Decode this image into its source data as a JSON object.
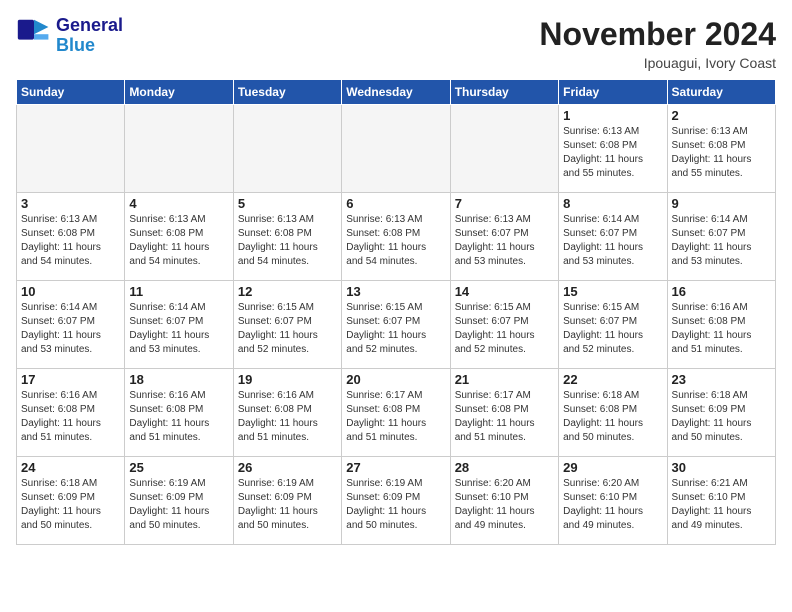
{
  "header": {
    "logo_line1": "General",
    "logo_line2": "Blue",
    "month_title": "November 2024",
    "location": "Ipouagui, Ivory Coast"
  },
  "weekdays": [
    "Sunday",
    "Monday",
    "Tuesday",
    "Wednesday",
    "Thursday",
    "Friday",
    "Saturday"
  ],
  "weeks": [
    [
      {
        "day": "",
        "info": ""
      },
      {
        "day": "",
        "info": ""
      },
      {
        "day": "",
        "info": ""
      },
      {
        "day": "",
        "info": ""
      },
      {
        "day": "",
        "info": ""
      },
      {
        "day": "1",
        "info": "Sunrise: 6:13 AM\nSunset: 6:08 PM\nDaylight: 11 hours\nand 55 minutes."
      },
      {
        "day": "2",
        "info": "Sunrise: 6:13 AM\nSunset: 6:08 PM\nDaylight: 11 hours\nand 55 minutes."
      }
    ],
    [
      {
        "day": "3",
        "info": "Sunrise: 6:13 AM\nSunset: 6:08 PM\nDaylight: 11 hours\nand 54 minutes."
      },
      {
        "day": "4",
        "info": "Sunrise: 6:13 AM\nSunset: 6:08 PM\nDaylight: 11 hours\nand 54 minutes."
      },
      {
        "day": "5",
        "info": "Sunrise: 6:13 AM\nSunset: 6:08 PM\nDaylight: 11 hours\nand 54 minutes."
      },
      {
        "day": "6",
        "info": "Sunrise: 6:13 AM\nSunset: 6:08 PM\nDaylight: 11 hours\nand 54 minutes."
      },
      {
        "day": "7",
        "info": "Sunrise: 6:13 AM\nSunset: 6:07 PM\nDaylight: 11 hours\nand 53 minutes."
      },
      {
        "day": "8",
        "info": "Sunrise: 6:14 AM\nSunset: 6:07 PM\nDaylight: 11 hours\nand 53 minutes."
      },
      {
        "day": "9",
        "info": "Sunrise: 6:14 AM\nSunset: 6:07 PM\nDaylight: 11 hours\nand 53 minutes."
      }
    ],
    [
      {
        "day": "10",
        "info": "Sunrise: 6:14 AM\nSunset: 6:07 PM\nDaylight: 11 hours\nand 53 minutes."
      },
      {
        "day": "11",
        "info": "Sunrise: 6:14 AM\nSunset: 6:07 PM\nDaylight: 11 hours\nand 53 minutes."
      },
      {
        "day": "12",
        "info": "Sunrise: 6:15 AM\nSunset: 6:07 PM\nDaylight: 11 hours\nand 52 minutes."
      },
      {
        "day": "13",
        "info": "Sunrise: 6:15 AM\nSunset: 6:07 PM\nDaylight: 11 hours\nand 52 minutes."
      },
      {
        "day": "14",
        "info": "Sunrise: 6:15 AM\nSunset: 6:07 PM\nDaylight: 11 hours\nand 52 minutes."
      },
      {
        "day": "15",
        "info": "Sunrise: 6:15 AM\nSunset: 6:07 PM\nDaylight: 11 hours\nand 52 minutes."
      },
      {
        "day": "16",
        "info": "Sunrise: 6:16 AM\nSunset: 6:08 PM\nDaylight: 11 hours\nand 51 minutes."
      }
    ],
    [
      {
        "day": "17",
        "info": "Sunrise: 6:16 AM\nSunset: 6:08 PM\nDaylight: 11 hours\nand 51 minutes."
      },
      {
        "day": "18",
        "info": "Sunrise: 6:16 AM\nSunset: 6:08 PM\nDaylight: 11 hours\nand 51 minutes."
      },
      {
        "day": "19",
        "info": "Sunrise: 6:16 AM\nSunset: 6:08 PM\nDaylight: 11 hours\nand 51 minutes."
      },
      {
        "day": "20",
        "info": "Sunrise: 6:17 AM\nSunset: 6:08 PM\nDaylight: 11 hours\nand 51 minutes."
      },
      {
        "day": "21",
        "info": "Sunrise: 6:17 AM\nSunset: 6:08 PM\nDaylight: 11 hours\nand 51 minutes."
      },
      {
        "day": "22",
        "info": "Sunrise: 6:18 AM\nSunset: 6:08 PM\nDaylight: 11 hours\nand 50 minutes."
      },
      {
        "day": "23",
        "info": "Sunrise: 6:18 AM\nSunset: 6:09 PM\nDaylight: 11 hours\nand 50 minutes."
      }
    ],
    [
      {
        "day": "24",
        "info": "Sunrise: 6:18 AM\nSunset: 6:09 PM\nDaylight: 11 hours\nand 50 minutes."
      },
      {
        "day": "25",
        "info": "Sunrise: 6:19 AM\nSunset: 6:09 PM\nDaylight: 11 hours\nand 50 minutes."
      },
      {
        "day": "26",
        "info": "Sunrise: 6:19 AM\nSunset: 6:09 PM\nDaylight: 11 hours\nand 50 minutes."
      },
      {
        "day": "27",
        "info": "Sunrise: 6:19 AM\nSunset: 6:09 PM\nDaylight: 11 hours\nand 50 minutes."
      },
      {
        "day": "28",
        "info": "Sunrise: 6:20 AM\nSunset: 6:10 PM\nDaylight: 11 hours\nand 49 minutes."
      },
      {
        "day": "29",
        "info": "Sunrise: 6:20 AM\nSunset: 6:10 PM\nDaylight: 11 hours\nand 49 minutes."
      },
      {
        "day": "30",
        "info": "Sunrise: 6:21 AM\nSunset: 6:10 PM\nDaylight: 11 hours\nand 49 minutes."
      }
    ]
  ]
}
